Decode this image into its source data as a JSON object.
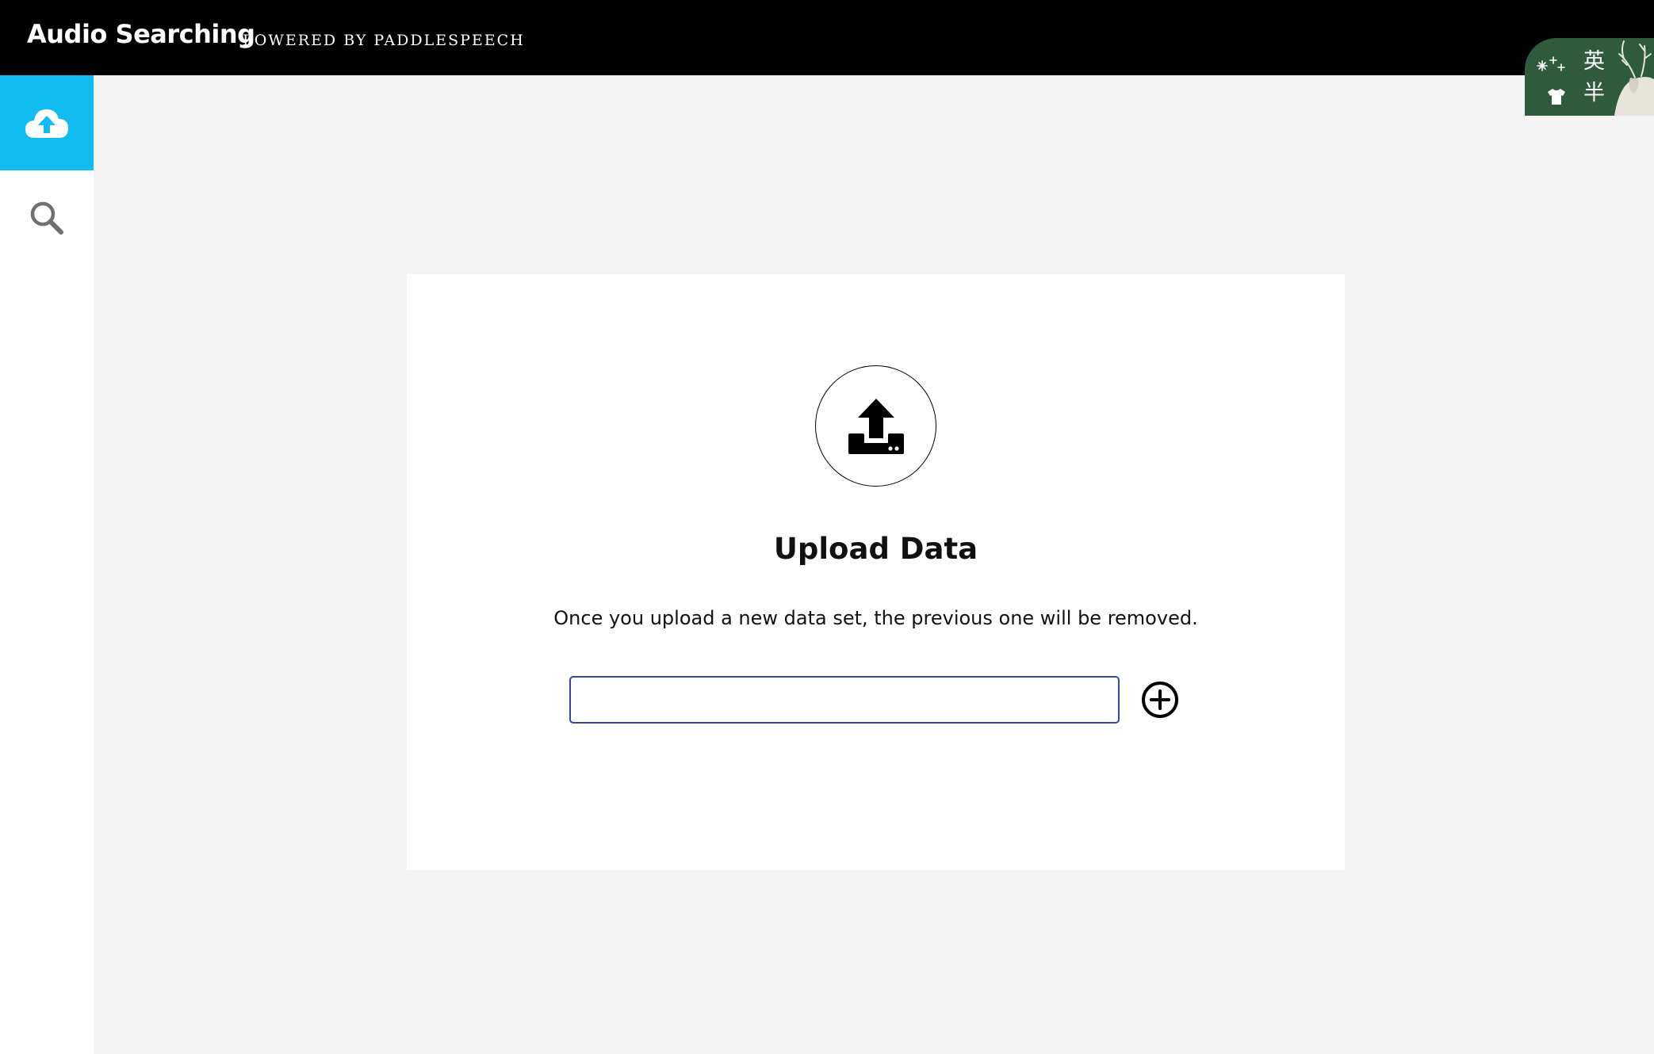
{
  "header": {
    "title": "Audio Searching",
    "subtitle": "POWERED BY PADDLESPEECH",
    "background_color": "#000000"
  },
  "widget": {
    "char_top": "英",
    "char_bottom": "半",
    "icons": [
      "shirt-icon",
      "snowflake-icon",
      "deer-icon"
    ]
  },
  "sidebar": {
    "items": [
      {
        "name": "upload",
        "icon": "cloud-upload-icon",
        "active": true,
        "active_color": "#10bcf0"
      },
      {
        "name": "search",
        "icon": "search-icon",
        "active": false
      }
    ]
  },
  "upload_card": {
    "icon": "upload-icon",
    "title": "Upload Data",
    "description": "Once you upload a new data set, the previous one will be removed.",
    "input_value": "",
    "input_border_color": "#3a44a2",
    "add_icon": "plus-circle-icon"
  }
}
